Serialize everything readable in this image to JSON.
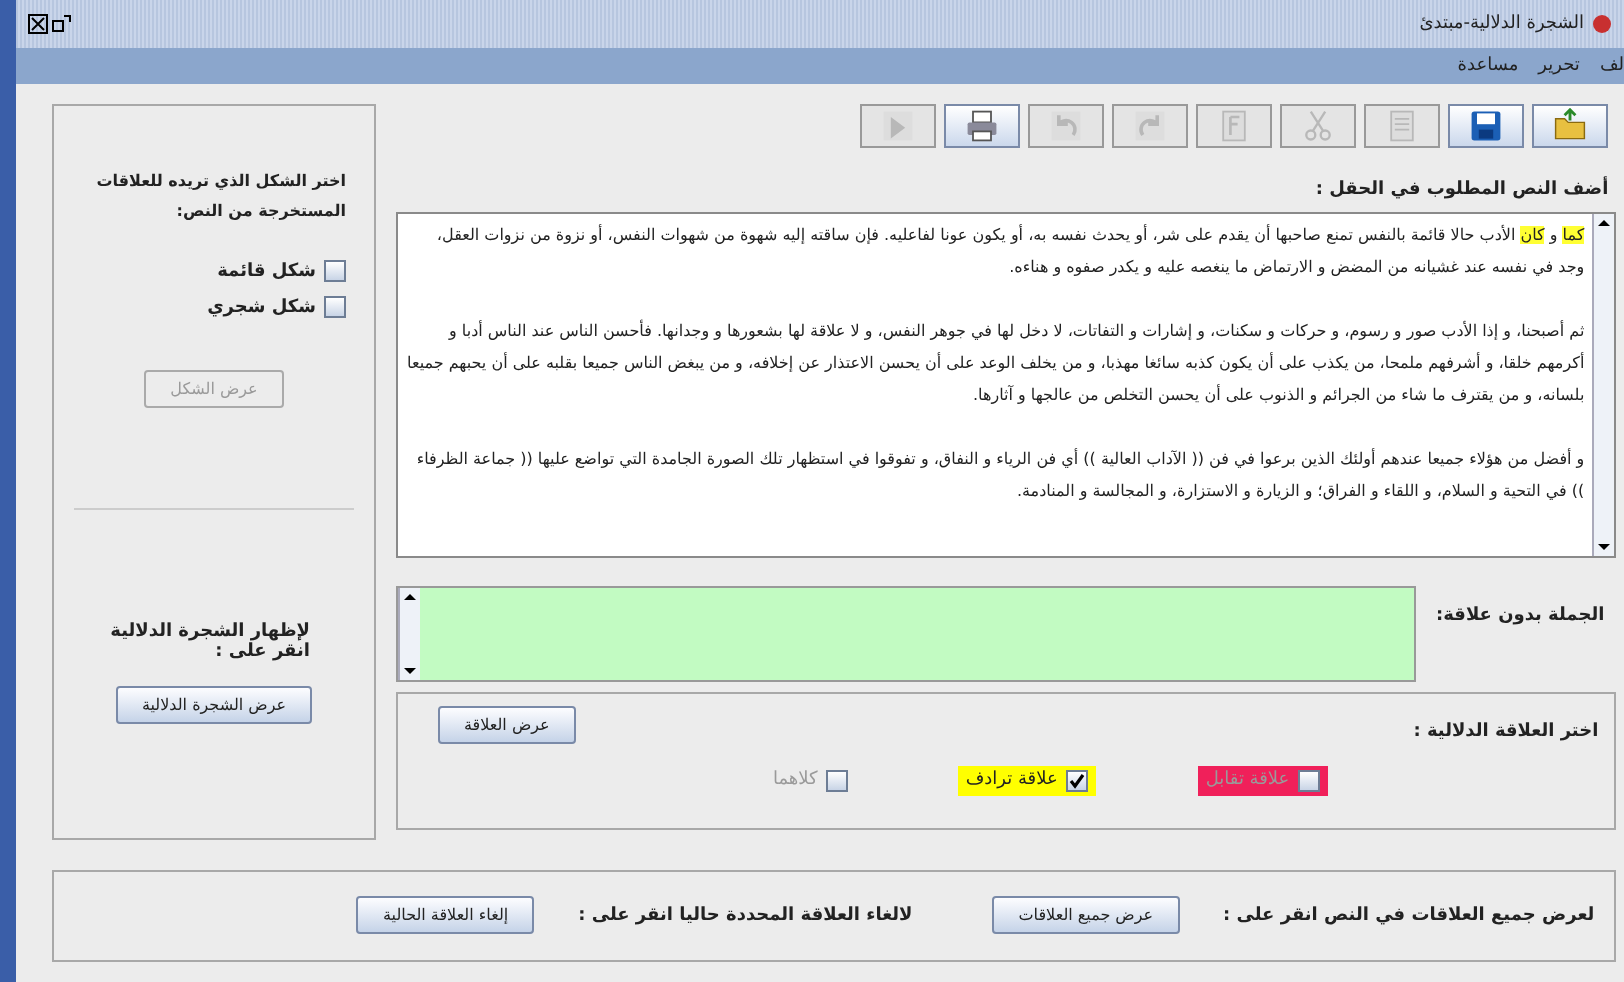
{
  "window": {
    "title": "الشجرة الدلالية-مبتدئ"
  },
  "menu": [
    {
      "label": "لف"
    },
    {
      "label": "تحرير"
    },
    {
      "label": "مساعدة"
    }
  ],
  "toolbar": [
    {
      "kind": "open",
      "disabled": false
    },
    {
      "kind": "save",
      "disabled": false
    },
    {
      "kind": "page",
      "disabled": true
    },
    {
      "kind": "cut",
      "disabled": true
    },
    {
      "kind": "format",
      "disabled": true
    },
    {
      "kind": "redo",
      "disabled": true
    },
    {
      "kind": "undo",
      "disabled": true
    },
    {
      "kind": "print",
      "disabled": false
    },
    {
      "kind": "export",
      "disabled": true
    }
  ],
  "shape_panel": {
    "prompt": "اختر الشكل الذي تريده للعلاقات المستخرجة من النص:",
    "options": [
      {
        "label": "شكل قائمة",
        "checked": false
      },
      {
        "label": "شكل شجري",
        "checked": false
      }
    ],
    "button": {
      "label": "عرض الشكل",
      "disabled": true
    },
    "tree_prompt": "لإظهار الشجرة الدلالية انقر على :",
    "tree_button": {
      "label": "عرض الشجرة الدلالية",
      "disabled": false
    }
  },
  "text_input": {
    "label": "أضف النص المطلوب في الحقل :",
    "paragraphs": [
      [
        {
          "text": "كما",
          "highlighted": true
        },
        {
          "text": " و ",
          "highlighted": false
        },
        {
          "text": "كان",
          "highlighted": true
        },
        {
          "text": " الأدب حالا قائمة بالنفس تمنع صاحبها أن يقدم على شر، أو يحدث نفسه به، أو يكون عونا لفاعليه. فإن ساقته إليه شهوة من شهوات النفس، أو نزوة من نزوات العقل، وجد في نفسه عند غشيانه من المضض و الارتماض ما ينغصه عليه و يكدر صفوه و هناءه.",
          "highlighted": false
        }
      ],
      [
        {
          "text": "ثم أصبحنا، و إذا الأدب صور و رسوم، و حركات و سكنات، و إشارات و التفاتات، لا دخل لها في جوهر النفس، و لا علاقة لها بشعورها و وجدانها. فأحسن الناس عند الناس أدبا و أكرمهم خلقا، و أشرفهم ملمحا، من يكذب على أن يكون كذبه سائغا مهذبا، و من يخلف الوعد على أن يحسن الاعتذار عن إخلافه، و من يبغض الناس جميعا بقلبه على أن يحبهم جميعا بلسانه، و من يقترف ما شاء من الجرائم و الذنوب على أن يحسن التخلص من عالجها و آثارها.",
          "highlighted": false
        }
      ],
      [
        {
          "text": "و أفضل من هؤلاء جميعا عندهم أولئك الذين برعوا في فن (( الآداب العالية )) أي فن الرياء و النفاق، و تفوقوا في استظهار تلك الصورة الجامدة التي تواضع عليها (( جماعة الظرفاء )) في التحية و السلام، و اللقاء و الفراق؛ و الزيارة و الاستزارة، و المجالسة و المنادمة.",
          "highlighted": false
        }
      ]
    ]
  },
  "sentence_field": {
    "label": "الجملة بدون علاقة:"
  },
  "relation_panel": {
    "label": "اختر العلاقة الدلالية :",
    "button": {
      "label": "عرض العلاقة",
      "disabled": false
    },
    "options": [
      {
        "label": "علاقة تقابل",
        "checked": false,
        "disabled": true,
        "color": "#f0205a"
      },
      {
        "label": "علاقة ترادف",
        "checked": true,
        "disabled": false,
        "color": "#ffff00"
      },
      {
        "label": "كلاهما",
        "checked": false,
        "disabled": true,
        "color": "#ececec"
      }
    ]
  },
  "bottom_panel": [
    {
      "prompt": "لعرض جميع العلاقات في النص انقر على :",
      "button": "عرض جميع العلاقات"
    },
    {
      "prompt": "لالغاء العلاقة المحددة حاليا انقر على :",
      "button": "إلغاء العلاقة الحالية"
    }
  ]
}
